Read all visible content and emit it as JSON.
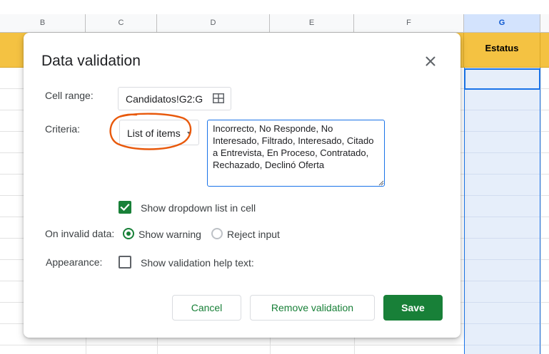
{
  "sheet": {
    "columns": [
      "B",
      "C",
      "D",
      "E",
      "F",
      "G"
    ],
    "header_cell_label": "Estatus"
  },
  "dialog": {
    "title": "Data validation",
    "close_icon": "close-icon",
    "cell_range": {
      "label": "Cell range:",
      "value": "Candidatos!G2:G",
      "icon": "grid-select-icon"
    },
    "criteria": {
      "label": "Criteria:",
      "selected": "List of items",
      "values": "Incorrecto, No Responde, No Interesado, Filtrado, Interesado, Citado a Entrevista, En Proceso, Contratado, Rechazado, Declinó Oferta"
    },
    "show_dropdown": {
      "label": "Show dropdown list in cell",
      "checked": true
    },
    "on_invalid": {
      "label": "On invalid data:",
      "options": [
        "Show warning",
        "Reject input"
      ],
      "selected": "Show warning"
    },
    "appearance": {
      "label": "Appearance:",
      "help_text_label": "Show validation help text:",
      "checked": false
    },
    "buttons": {
      "cancel": "Cancel",
      "remove": "Remove validation",
      "save": "Save"
    }
  },
  "colors": {
    "accent_green": "#188038",
    "header_yellow": "#f4c242",
    "selection_blue": "#1a73e8",
    "annotation_orange": "#e8590c"
  }
}
